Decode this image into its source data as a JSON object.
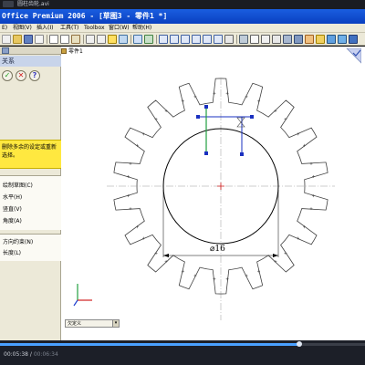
{
  "player": {
    "file_title": "圆柱齿轮.avi",
    "current_time": "00:05:38",
    "total_time": "00:06:34",
    "progress": 0.82
  },
  "app": {
    "title": "Office Premium 2006 - [草图3 - 零件1 *]"
  },
  "menu": [
    "E)",
    "视图(V)",
    "插入(I)",
    "工具(T)",
    "Toolbox",
    "窗口(W)",
    "帮助(H)"
  ],
  "panel": {
    "title": "关系",
    "ok_glyph": "✓",
    "cancel_glyph": "✕",
    "help_glyph": "?",
    "message": "删除多余的设定或重新选择。",
    "options": [
      "绘制草图(C)",
      "水平(H)",
      "竖直(V)",
      "角度(A)"
    ],
    "parameters": [
      "方向约束(N)",
      "长度(L)"
    ]
  },
  "canvas": {
    "part_label": "零件1",
    "dimension_label": "⌀16",
    "status_label": "欠定义",
    "status_arrow": "▾"
  },
  "colors": {
    "title_bar": "#0a3fc0",
    "sketch_line": "#404040",
    "selected_line": "#1a30c0",
    "relation_green": "#20a040",
    "origin_red": "#d02020"
  }
}
